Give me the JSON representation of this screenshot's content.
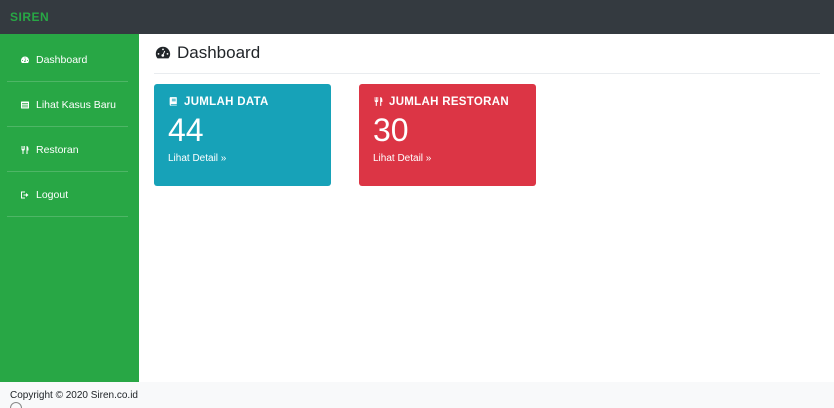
{
  "brand": "SIREN",
  "colors": {
    "topbar": "#343a40",
    "sidebar": "#28a745",
    "card_teal": "#17a2b8",
    "card_red": "#dc3545"
  },
  "sidebar": {
    "items": [
      {
        "label": "Dashboard",
        "icon": "dashboard-icon"
      },
      {
        "label": "Lihat Kasus Baru",
        "icon": "list-icon"
      },
      {
        "label": "Restoran",
        "icon": "utensils-icon"
      },
      {
        "label": "Logout",
        "icon": "logout-icon"
      }
    ]
  },
  "page": {
    "title": "Dashboard",
    "icon": "tachometer-icon"
  },
  "cards": [
    {
      "title": "JUMLAH DATA",
      "value": "44",
      "link": "Lihat Detail »",
      "icon": "book-icon"
    },
    {
      "title": "JUMLAH RESTORAN",
      "value": "30",
      "link": "Lihat Detail »",
      "icon": "utensils-icon"
    }
  ],
  "footer": {
    "text": "Copyright © 2020 Siren.co.id"
  }
}
